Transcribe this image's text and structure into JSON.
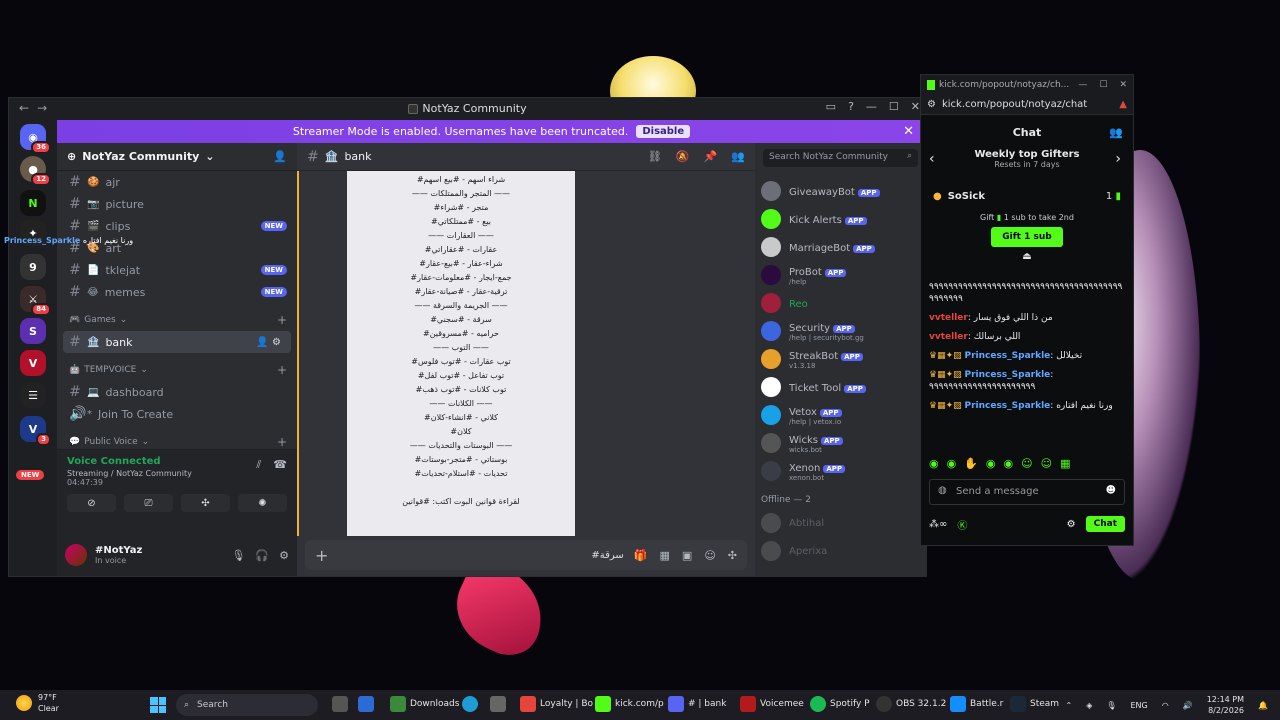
{
  "discord": {
    "window_title": "NotYaz Community",
    "nav_back": "←",
    "nav_fwd": "→",
    "streamer_text": "Streamer Mode is enabled. Usernames have been truncated.",
    "streamer_disable": "Disable",
    "server_name": "NotYaz Community",
    "rail_badges": [
      "36",
      "12",
      "84",
      "3"
    ],
    "rail_new": "NEW",
    "channels_top": [
      {
        "name": "ajr",
        "emoji": "🍪",
        "badge": ""
      },
      {
        "name": "picture",
        "emoji": "📷",
        "badge": ""
      },
      {
        "name": "clips",
        "emoji": "🎬",
        "badge": "NEW"
      },
      {
        "name": "art",
        "emoji": "🎨",
        "badge": ""
      },
      {
        "name": "tklejat",
        "emoji": "📄",
        "badge": "NEW"
      },
      {
        "name": "memes",
        "emoji": "😂",
        "badge": "NEW"
      }
    ],
    "category_games": "Games",
    "active_channel": "bank",
    "category_tempvoice": "TEMPVOICE",
    "channel_dashboard": "dashboard",
    "channel_join": "Join To Create",
    "category_public_voice": "Public Voice",
    "voice_connected": "Voice Connected",
    "voice_server": "Streaming / NotYaz Community",
    "voice_time": "04:47:39",
    "username": "#NotYaz",
    "user_status": "In voice",
    "chat_header": "bank",
    "search_placeholder": "Search NotYaz Community",
    "input_text": "#سرقة",
    "image_lines": [
      "#شراء اسهم - #بيع اسهم",
      "—— المتجر والممتلكات ——",
      "#متجر - #شراء",
      "#بيع - #ممتلكاتي",
      "—— العقارات ——",
      "#عقارات - #عقاراتي",
      "#شراء-عقار - #بيع-عقار",
      "#جمع-ايجار - #معلومات-عقار",
      "#ترقية-عقار - #صيانة-عقار",
      "—— الجريمة والسرقة ——",
      "#سرقة - #سجني",
      "#حراميه - #مسروقين",
      "—— التوب ——",
      "#توب عقارات - #توب فلوس",
      "#توب تفاعل - #توب لفل",
      "#توب كلانات - #توب ذهب",
      "—— الكلانات ——",
      "#كلاني - #انشاء-كلان",
      "#كلان",
      "—— البوستات والتحديات ——",
      "#بوستاتي - #متجر-بوستات",
      "#تحديات - #استلام-تحديات",
      "",
      "لقراءة قوانين البوت اكتب: #قوانين"
    ],
    "members": [
      {
        "name": "GiveawayBot",
        "app": "APP",
        "sub": "",
        "color": "#6d6f78"
      },
      {
        "name": "Kick Alerts",
        "app": "APP",
        "sub": "",
        "color": "#53fc18"
      },
      {
        "name": "MarriageBot",
        "app": "APP",
        "sub": "",
        "color": "#c9c9c9"
      },
      {
        "name": "ProBot",
        "app": "APP",
        "sub": "/help",
        "color": "#2b0a3d"
      },
      {
        "name": "Reo",
        "app": "",
        "sub": "",
        "color": "#a01f3b"
      },
      {
        "name": "Security",
        "app": "APP",
        "sub": "/help | securitybot.gg",
        "color": "#3b66e0"
      },
      {
        "name": "StreakBot",
        "app": "APP",
        "sub": "v1.3.18",
        "color": "#e8a02d"
      },
      {
        "name": "Ticket Tool",
        "app": "APP",
        "sub": "",
        "color": "#ffffff"
      },
      {
        "name": "Vetox",
        "app": "APP",
        "sub": "/help | vetox.io",
        "color": "#1aa0e6"
      },
      {
        "name": "Wicks",
        "app": "APP",
        "sub": "wicks.bot",
        "color": "#555555"
      },
      {
        "name": "Xenon",
        "app": "APP",
        "sub": "xenon.bot",
        "color": "#3a3d45"
      }
    ],
    "offline_label": "Offline — 2",
    "offline_members": [
      {
        "name": "Abtihal"
      },
      {
        "name": "Aperixa"
      }
    ]
  },
  "kick": {
    "title_url": "kick.com/popout/notyaz/ch...",
    "url": "kick.com/popout/notyaz/chat",
    "chat_label": "Chat",
    "gifters_title": "Weekly top Gifters",
    "gifters_sub": "Resets in 7 days",
    "top_gifter": "SoSick",
    "top_count": "1",
    "gift_line_pre": "Gift",
    "gift_line_post": "1 sub to take 2nd",
    "gift_btn": "Gift 1 sub",
    "messages": [
      {
        "name": "",
        "text": "٩٩٩٩٩٩٩٩٩٩٩٩٩٩٩٩٩٩٩٩٩٩٩٩٩٩٩٩٩٩٩٩٩٩٩٩٩٩٩٩٩٩٩٩٩٩٩"
      },
      {
        "name": "vvteller",
        "text": "من ذا اللي فوق يسار"
      },
      {
        "name": "vvteller",
        "text": "اللي برسالك"
      },
      {
        "name": "Princess_Sparkle",
        "text": "تخيلالل"
      },
      {
        "name": "Princess_Sparkle",
        "text": "٩٩٩٩٩٩٩٩٩٩٩٩٩٩٩٩٩٩٩٩٩٩"
      },
      {
        "name": "Princess_Sparkle",
        "text": "ورنا نغيم افتاره"
      }
    ],
    "input_placeholder": "Send a message",
    "chat_btn": "Chat"
  },
  "overlay": {
    "floating_name": "Princess_Sparkle",
    "floating_text": "ورنا نغيم افتاره"
  },
  "taskbar": {
    "temp": "97°F",
    "weather": "Clear",
    "search": "Search",
    "items": [
      "Downloads",
      "Loyalty | Bo",
      "kick.com/p",
      "# | bank",
      "Voicemee",
      "Spotify P",
      "OBS 32.1.2",
      "Battle.r",
      "Steam"
    ],
    "lang": "ENG",
    "time": "12:14 PM",
    "date": "8/2/2026"
  }
}
